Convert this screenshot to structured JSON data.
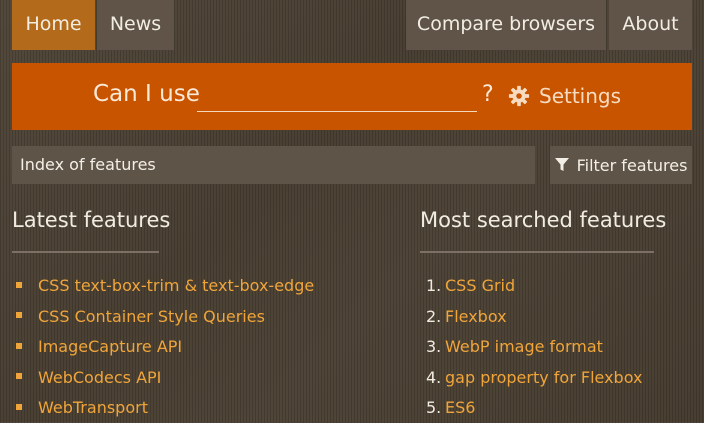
{
  "nav": {
    "home": "Home",
    "news": "News",
    "compare": "Compare browsers",
    "about": "About"
  },
  "search": {
    "label": "Can I use",
    "value": "",
    "suffix": "?",
    "settings_label": "Settings"
  },
  "index_bar": {
    "label": "Index of features",
    "filter_label": "Filter features"
  },
  "latest": {
    "title": "Latest features",
    "items": [
      "CSS text-box-trim & text-box-edge",
      "CSS Container Style Queries",
      "ImageCapture API",
      "WebCodecs API",
      "WebTransport"
    ]
  },
  "most_searched": {
    "title": "Most searched features",
    "items": [
      {
        "num": "1.",
        "label": "CSS Grid"
      },
      {
        "num": "2.",
        "label": "Flexbox"
      },
      {
        "num": "3.",
        "label": "WebP image format"
      },
      {
        "num": "4.",
        "label": "gap property for Flexbox"
      },
      {
        "num": "5.",
        "label": "ES6"
      }
    ]
  },
  "colors": {
    "accent": "#c95400",
    "active_tab": "#b36a1a",
    "link": "#f0a53a"
  }
}
